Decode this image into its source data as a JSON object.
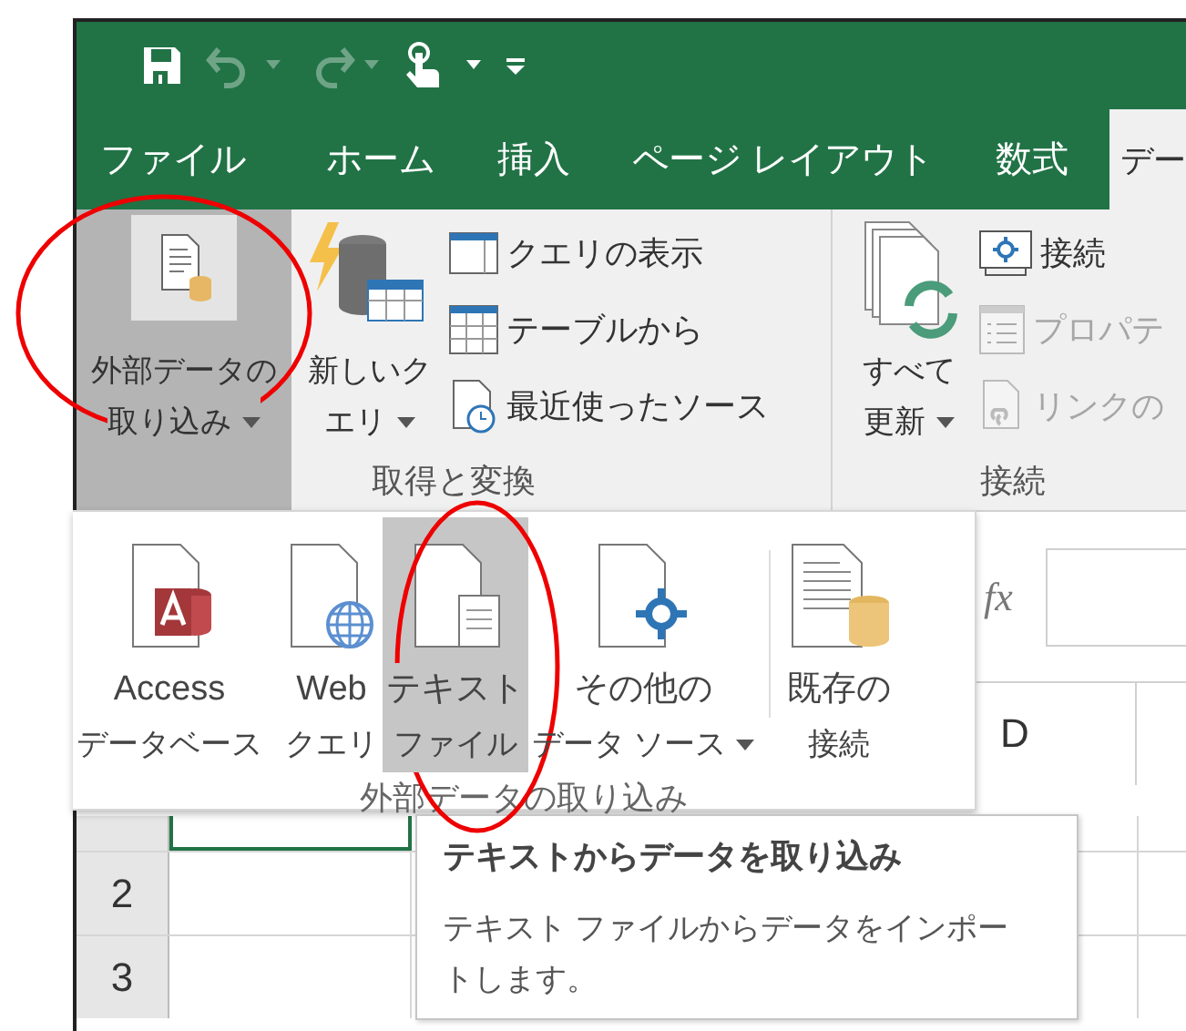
{
  "quick_access": [
    {
      "kind": "save",
      "disabled": false
    },
    {
      "kind": "undo",
      "disabled": true
    },
    {
      "kind": "redo",
      "disabled": true
    },
    {
      "kind": "touch",
      "disabled": false
    },
    {
      "kind": "customize",
      "disabled": false
    }
  ],
  "tabs": [
    {
      "label": "ファイル",
      "selected": false
    },
    {
      "label": "ホーム",
      "selected": false
    },
    {
      "label": "挿入",
      "selected": false
    },
    {
      "label": "ページ レイアウト",
      "selected": false
    },
    {
      "label": "数式",
      "selected": false
    },
    {
      "label": "デー",
      "selected": true
    }
  ],
  "ribbon": {
    "groups": [
      {
        "label": "取得と変換",
        "large_buttons": [
          {
            "kind": "external",
            "lines": [
              "外部データの",
              "取り込み"
            ],
            "dropdown": true,
            "selected": true
          },
          {
            "kind": "new_query",
            "lines": [
              "新しいク",
              "エリ"
            ],
            "dropdown": true,
            "selected": false
          }
        ],
        "small_buttons": [
          {
            "kind": "show_queries",
            "label": "クエリの表示",
            "disabled": false
          },
          {
            "kind": "from_table",
            "label": "テーブルから",
            "disabled": false
          },
          {
            "kind": "recent",
            "label": "最近使ったソース",
            "disabled": false
          }
        ]
      },
      {
        "label": "接続",
        "large_buttons": [
          {
            "kind": "refresh",
            "lines": [
              "すべて",
              "更新"
            ],
            "dropdown": true,
            "selected": false
          }
        ],
        "small_buttons": [
          {
            "kind": "connections",
            "label": "接続",
            "disabled": false
          },
          {
            "kind": "properties",
            "label": "プロパテ",
            "disabled": true
          },
          {
            "kind": "edit_links",
            "label": "リンクの",
            "disabled": true
          }
        ]
      }
    ]
  },
  "dropdown": {
    "label": "外部データの取り込み",
    "items": [
      {
        "kind": "access",
        "lines": [
          "Access",
          "データベース"
        ],
        "selected": false,
        "dropdown": false
      },
      {
        "kind": "web",
        "lines": [
          "Web",
          "クエリ"
        ],
        "selected": false,
        "dropdown": false
      },
      {
        "kind": "text",
        "lines": [
          "テキスト",
          "ファイル"
        ],
        "selected": true,
        "dropdown": false
      },
      {
        "kind": "other",
        "lines": [
          "その他の",
          "データ ソース"
        ],
        "selected": false,
        "dropdown": true
      },
      {
        "kind": "existing",
        "lines": [
          "既存の",
          "接続"
        ],
        "selected": false,
        "dropdown": false
      }
    ]
  },
  "formula_bar": {
    "function_label": "fx"
  },
  "sheet": {
    "column_header": "D",
    "row_headers": [
      "2",
      "3"
    ],
    "active_cell": true
  },
  "tooltip": {
    "title": "テキストからデータを取り込み",
    "description": "テキスト ファイルからデータをインポートします。"
  }
}
